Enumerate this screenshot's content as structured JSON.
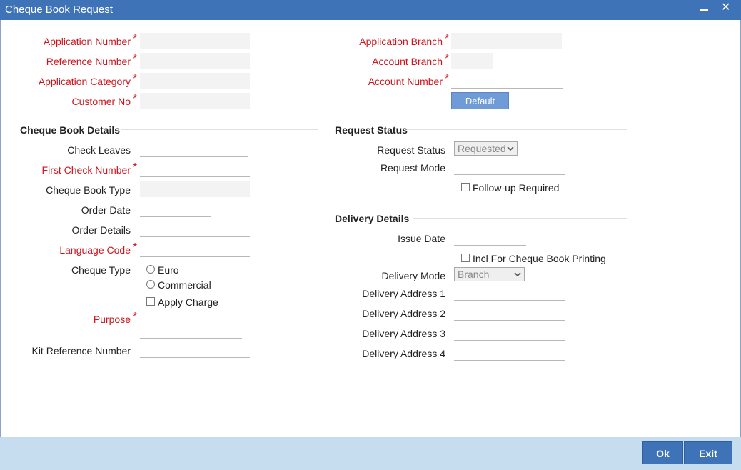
{
  "window": {
    "title": "Cheque Book Request",
    "minimize": "▬",
    "close": "✕"
  },
  "header_left": {
    "application_number": "Application Number",
    "reference_number": "Reference Number",
    "application_category": "Application Category",
    "customer_no": "Customer No"
  },
  "header_right": {
    "application_branch": "Application Branch",
    "account_branch": "Account Branch",
    "account_number": "Account Number",
    "default_button": "Default"
  },
  "required_mark": "*",
  "cheque_book_details": {
    "heading": "Cheque Book Details",
    "check_leaves": "Check Leaves",
    "first_check_number": "First Check Number",
    "cheque_book_type": "Cheque Book Type",
    "order_date": "Order Date",
    "order_details": "Order Details",
    "language_code": "Language Code",
    "cheque_type": "Cheque Type",
    "euro": "Euro",
    "commercial": "Commercial",
    "apply_charge": "Apply Charge",
    "purpose": "Purpose",
    "kit_reference_number": "Kit Reference Number"
  },
  "request_status": {
    "heading": "Request Status",
    "request_status_label": "Request Status",
    "request_status_value": "Requested",
    "request_mode": "Request Mode",
    "follow_up_required": "Follow-up Required"
  },
  "delivery_details": {
    "heading": "Delivery Details",
    "issue_date": "Issue Date",
    "incl_cheque_book_printing": "Incl For Cheque Book Printing",
    "delivery_mode_label": "Delivery Mode",
    "delivery_mode_value": "Branch",
    "delivery_address_1": "Delivery Address 1",
    "delivery_address_2": "Delivery Address 2",
    "delivery_address_3": "Delivery Address 3",
    "delivery_address_4": "Delivery Address 4"
  },
  "footer": {
    "ok": "Ok",
    "exit": "Exit"
  }
}
